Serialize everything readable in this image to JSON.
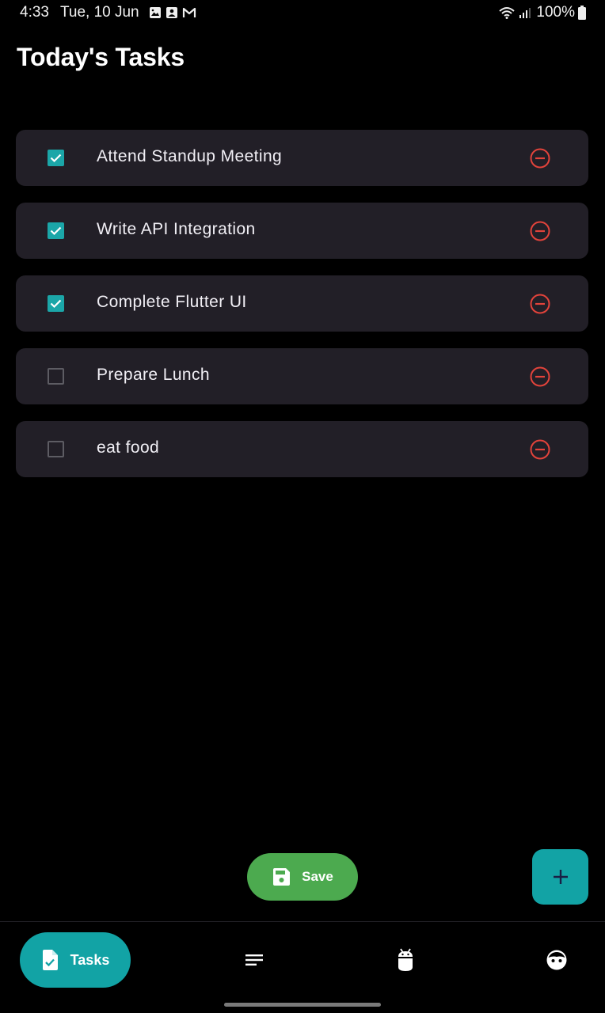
{
  "status_bar": {
    "time": "4:33",
    "date": "Tue, 10 Jun",
    "notification_icons": [
      "gallery-icon",
      "contact-card-icon",
      "gmail-icon"
    ],
    "battery": "100%"
  },
  "title": "Today's Tasks",
  "tasks": [
    {
      "label": "Attend Standup Meeting",
      "done": true
    },
    {
      "label": "Write API Integration",
      "done": true
    },
    {
      "label": "Complete Flutter UI",
      "done": true
    },
    {
      "label": "Prepare Lunch",
      "done": false
    },
    {
      "label": "eat food",
      "done": false
    }
  ],
  "save_button": {
    "label": "Save",
    "icon": "floppy-disk-icon"
  },
  "fab": {
    "icon": "plus-icon"
  },
  "bottom_nav": {
    "items": [
      {
        "label": "Tasks",
        "icon": "task-document-icon",
        "active": true
      },
      {
        "label": "",
        "icon": "notes-icon",
        "active": false
      },
      {
        "label": "",
        "icon": "android-icon",
        "active": false
      },
      {
        "label": "",
        "icon": "profile-face-icon",
        "active": false
      }
    ]
  },
  "colors": {
    "background": "#000000",
    "card": "#221f27",
    "accent": "#12a3a5",
    "checkbox_checked": "#1ba6a8",
    "remove": "#e2433b",
    "save": "#4caa4f"
  }
}
